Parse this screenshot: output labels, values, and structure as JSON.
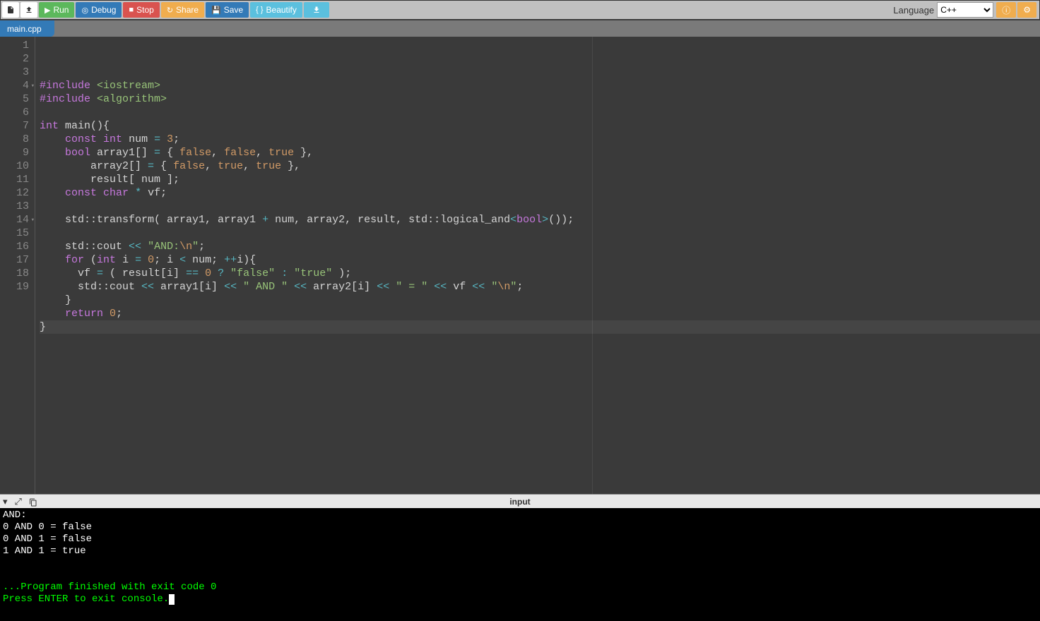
{
  "toolbar": {
    "run": "Run",
    "debug": "Debug",
    "stop": "Stop",
    "share": "Share",
    "save": "Save",
    "beautify": "Beautify",
    "language_label": "Language",
    "language_value": "C++"
  },
  "tab": {
    "filename": "main.cpp"
  },
  "editor": {
    "line_count": 19,
    "fold_lines": [
      4,
      14
    ],
    "active_line": 19,
    "source_plain": "#include <iostream>\n#include <algorithm>\n\nint main(){\n    const int num = 3;\n    bool array1[] = { false, false, true },\n        array2[] = { false, true, true },\n        result[ num ];\n    const char * vf;\n\n    std::transform( array1, array1 + num, array2, result, std::logical_and<bool>());\n\n    std::cout << \"AND:\\n\";\n    for (int i = 0; i < num; ++i){\n      vf = ( result[i] == 0 ? \"false\" : \"true\" );\n      std::cout << array1[i] << \" AND \" << array2[i] << \" = \" << vf << \"\\n\";\n    }\n    return 0;\n}",
    "lines": [
      [
        {
          "c": "purple",
          "t": "#include"
        },
        {
          "c": "",
          "t": " "
        },
        {
          "c": "green",
          "t": "<iostream>"
        }
      ],
      [
        {
          "c": "purple",
          "t": "#include"
        },
        {
          "c": "",
          "t": " "
        },
        {
          "c": "green",
          "t": "<algorithm>"
        }
      ],
      [],
      [
        {
          "c": "purple",
          "t": "int"
        },
        {
          "c": "",
          "t": " main(){"
        }
      ],
      [
        {
          "c": "",
          "t": "    "
        },
        {
          "c": "purple",
          "t": "const"
        },
        {
          "c": "",
          "t": " "
        },
        {
          "c": "purple",
          "t": "int"
        },
        {
          "c": "",
          "t": " num "
        },
        {
          "c": "cyan",
          "t": "="
        },
        {
          "c": "",
          "t": " "
        },
        {
          "c": "orange",
          "t": "3"
        },
        {
          "c": "",
          "t": ";"
        }
      ],
      [
        {
          "c": "",
          "t": "    "
        },
        {
          "c": "purple",
          "t": "bool"
        },
        {
          "c": "",
          "t": " array1[] "
        },
        {
          "c": "cyan",
          "t": "="
        },
        {
          "c": "",
          "t": " { "
        },
        {
          "c": "orange",
          "t": "false"
        },
        {
          "c": "",
          "t": ", "
        },
        {
          "c": "orange",
          "t": "false"
        },
        {
          "c": "",
          "t": ", "
        },
        {
          "c": "orange",
          "t": "true"
        },
        {
          "c": "",
          "t": " },"
        }
      ],
      [
        {
          "c": "",
          "t": "        array2[] "
        },
        {
          "c": "cyan",
          "t": "="
        },
        {
          "c": "",
          "t": " { "
        },
        {
          "c": "orange",
          "t": "false"
        },
        {
          "c": "",
          "t": ", "
        },
        {
          "c": "orange",
          "t": "true"
        },
        {
          "c": "",
          "t": ", "
        },
        {
          "c": "orange",
          "t": "true"
        },
        {
          "c": "",
          "t": " },"
        }
      ],
      [
        {
          "c": "",
          "t": "        result[ num ];"
        }
      ],
      [
        {
          "c": "",
          "t": "    "
        },
        {
          "c": "purple",
          "t": "const"
        },
        {
          "c": "",
          "t": " "
        },
        {
          "c": "purple",
          "t": "char"
        },
        {
          "c": "",
          "t": " "
        },
        {
          "c": "cyan",
          "t": "*"
        },
        {
          "c": "",
          "t": " vf;"
        }
      ],
      [],
      [
        {
          "c": "",
          "t": "    std::transform( array1, array1 "
        },
        {
          "c": "cyan",
          "t": "+"
        },
        {
          "c": "",
          "t": " num, array2, result, std::logical_and"
        },
        {
          "c": "cyan",
          "t": "<"
        },
        {
          "c": "purple",
          "t": "bool"
        },
        {
          "c": "cyan",
          "t": ">"
        },
        {
          "c": "",
          "t": "());"
        }
      ],
      [],
      [
        {
          "c": "",
          "t": "    std::cout "
        },
        {
          "c": "cyan",
          "t": "<<"
        },
        {
          "c": "",
          "t": " "
        },
        {
          "c": "green",
          "t": "\"AND:"
        },
        {
          "c": "orange",
          "t": "\\n"
        },
        {
          "c": "green",
          "t": "\""
        },
        {
          "c": "",
          "t": ";"
        }
      ],
      [
        {
          "c": "",
          "t": "    "
        },
        {
          "c": "purple",
          "t": "for"
        },
        {
          "c": "",
          "t": " ("
        },
        {
          "c": "purple",
          "t": "int"
        },
        {
          "c": "",
          "t": " i "
        },
        {
          "c": "cyan",
          "t": "="
        },
        {
          "c": "",
          "t": " "
        },
        {
          "c": "orange",
          "t": "0"
        },
        {
          "c": "",
          "t": "; i "
        },
        {
          "c": "cyan",
          "t": "<"
        },
        {
          "c": "",
          "t": " num; "
        },
        {
          "c": "cyan",
          "t": "++"
        },
        {
          "c": "",
          "t": "i){"
        }
      ],
      [
        {
          "c": "",
          "t": "      vf "
        },
        {
          "c": "cyan",
          "t": "="
        },
        {
          "c": "",
          "t": " ( result[i] "
        },
        {
          "c": "cyan",
          "t": "=="
        },
        {
          "c": "",
          "t": " "
        },
        {
          "c": "orange",
          "t": "0"
        },
        {
          "c": "",
          "t": " "
        },
        {
          "c": "cyan",
          "t": "?"
        },
        {
          "c": "",
          "t": " "
        },
        {
          "c": "green",
          "t": "\"false\""
        },
        {
          "c": "",
          "t": " "
        },
        {
          "c": "cyan",
          "t": ":"
        },
        {
          "c": "",
          "t": " "
        },
        {
          "c": "green",
          "t": "\"true\""
        },
        {
          "c": "",
          "t": " );"
        }
      ],
      [
        {
          "c": "",
          "t": "      std::cout "
        },
        {
          "c": "cyan",
          "t": "<<"
        },
        {
          "c": "",
          "t": " array1[i] "
        },
        {
          "c": "cyan",
          "t": "<<"
        },
        {
          "c": "",
          "t": " "
        },
        {
          "c": "green",
          "t": "\" AND \""
        },
        {
          "c": "",
          "t": " "
        },
        {
          "c": "cyan",
          "t": "<<"
        },
        {
          "c": "",
          "t": " array2[i] "
        },
        {
          "c": "cyan",
          "t": "<<"
        },
        {
          "c": "",
          "t": " "
        },
        {
          "c": "green",
          "t": "\" = \""
        },
        {
          "c": "",
          "t": " "
        },
        {
          "c": "cyan",
          "t": "<<"
        },
        {
          "c": "",
          "t": " vf "
        },
        {
          "c": "cyan",
          "t": "<<"
        },
        {
          "c": "",
          "t": " "
        },
        {
          "c": "green",
          "t": "\""
        },
        {
          "c": "orange",
          "t": "\\n"
        },
        {
          "c": "green",
          "t": "\""
        },
        {
          "c": "",
          "t": ";"
        }
      ],
      [
        {
          "c": "",
          "t": "    }"
        }
      ],
      [
        {
          "c": "",
          "t": "    "
        },
        {
          "c": "purple",
          "t": "return"
        },
        {
          "c": "",
          "t": " "
        },
        {
          "c": "orange",
          "t": "0"
        },
        {
          "c": "",
          "t": ";"
        }
      ],
      [
        {
          "c": "",
          "t": "}"
        }
      ]
    ]
  },
  "console_bar": {
    "input_label": "input"
  },
  "console": {
    "output": [
      "AND:",
      "0 AND 0 = false",
      "0 AND 1 = false",
      "1 AND 1 = true",
      "",
      ""
    ],
    "status1": "...Program finished with exit code 0",
    "status2": "Press ENTER to exit console."
  }
}
